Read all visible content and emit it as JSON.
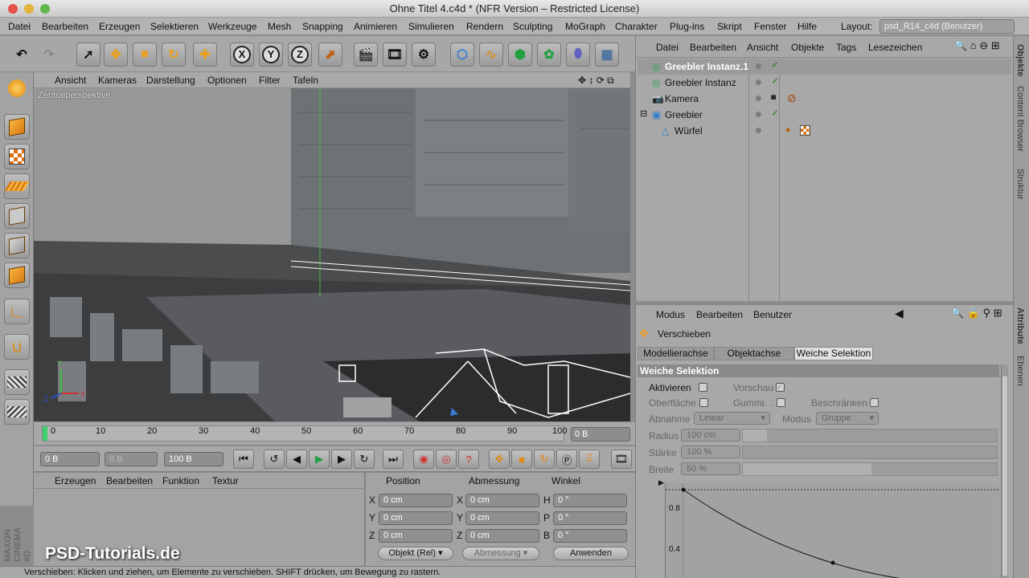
{
  "window": {
    "title": "Ohne Titel 4.c4d * (NFR Version – Restricted License)"
  },
  "menu": [
    "Datei",
    "Bearbeiten",
    "Erzeugen",
    "Selektieren",
    "Werkzeuge",
    "Mesh",
    "Snapping",
    "Animieren",
    "Simulieren",
    "Rendern",
    "Sculpting",
    "MoGraph",
    "Charakter",
    "Plug-ins",
    "Skript",
    "Fenster",
    "Hilfe"
  ],
  "layout": {
    "label": "Layout:",
    "value": "psd_R14_c4d (Benutzer)"
  },
  "viewport": {
    "menu": [
      "Ansicht",
      "Kameras",
      "Darstellung",
      "Optionen",
      "Filter",
      "Tafeln"
    ],
    "label": "Zentralperspektive"
  },
  "timeline": {
    "ticks": [
      "0",
      "10",
      "20",
      "30",
      "40",
      "50",
      "60",
      "70",
      "80",
      "90",
      "100"
    ],
    "current_frame": "0 B"
  },
  "transport": {
    "start": "0 B",
    "preview_start": "0 B",
    "end": "100 B"
  },
  "material_manager": {
    "menu": [
      "Erzeugen",
      "Bearbeiten",
      "Funktion",
      "Textur"
    ]
  },
  "coordinates": {
    "headers": [
      "Position",
      "Abmessung",
      "Winkel"
    ],
    "rows": [
      {
        "a": "X",
        "pos": "0 cm",
        "b": "X",
        "size": "0 cm",
        "c": "H",
        "rot": "0 °"
      },
      {
        "a": "Y",
        "pos": "0 cm",
        "b": "Y",
        "size": "0 cm",
        "c": "P",
        "rot": "0 °"
      },
      {
        "a": "Z",
        "pos": "0 cm",
        "b": "Z",
        "size": "0 cm",
        "c": "B",
        "rot": "0 °"
      }
    ],
    "mode": "Objekt (Rel)",
    "size_mode": "Abmessung",
    "apply": "Anwenden"
  },
  "status": "Verschieben: Klicken und ziehen, um Elemente zu verschieben. SHIFT drücken, um Bewegung zu rastern.",
  "watermark": "PSD-Tutorials.de",
  "maxon": "MAXON CINEMA 4D",
  "object_manager": {
    "menu": [
      "Datei",
      "Bearbeiten",
      "Ansicht",
      "Objekte",
      "Tags",
      "Lesezeichen"
    ],
    "objects": [
      {
        "name": "Greebler Instanz.1",
        "selected": true
      },
      {
        "name": "Greebler Instanz",
        "selected": false
      },
      {
        "name": "Kamera",
        "selected": false
      },
      {
        "name": "Greebler",
        "selected": false
      },
      {
        "name": "Würfel",
        "selected": false
      }
    ]
  },
  "side_tabs": [
    "Objekte",
    "Content Browser",
    "Struktur",
    "Attribute",
    "Ebenen"
  ],
  "attribute_manager": {
    "menu": [
      "Modus",
      "Bearbeiten",
      "Benutzer"
    ],
    "tool": "Verschieben",
    "tabs": [
      "Modellierachse",
      "Objektachse",
      "Weiche Selektion"
    ],
    "section": "Weiche Selektion",
    "aktivieren": "Aktivieren",
    "vorschau": "Vorschau",
    "oberflaeche": "Oberfläche",
    "gummi": "Gummi. .",
    "beschraenken": "Beschränken",
    "abnahme_label": "Abnahme",
    "abnahme": "Linear",
    "modus_label": "Modus",
    "modus": "Gruppe",
    "radius_label": "Radius",
    "radius": "100 cm",
    "staerke_label": "Stärke",
    "staerke": "100 %",
    "breite_label": "Breite",
    "breite": "50 %",
    "graph_labels": [
      "0.8",
      "0.4"
    ]
  },
  "colors": {
    "accent_orange": "#f0a030",
    "check_green": "#2a8a2a",
    "active_header": "#8a8a8a"
  }
}
